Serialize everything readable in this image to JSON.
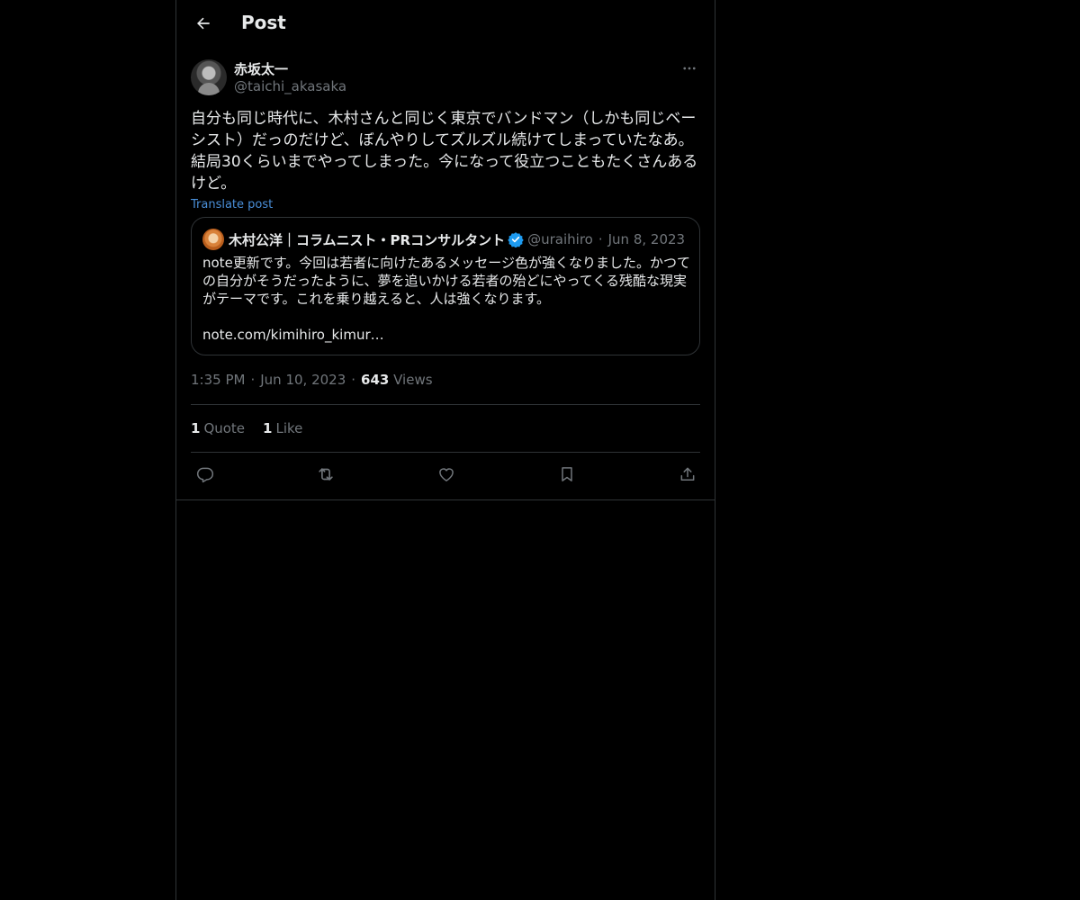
{
  "header": {
    "title": "Post"
  },
  "post": {
    "author_name": "赤坂太一",
    "author_handle": "@taichi_akasaka",
    "text": "自分も同じ時代に、木村さんと同じく東京でバンドマン（しかも同じベー\nシスト）だっのだけど、ぼんやりしてズルズル続けてしまっていたなあ。\n結局30くらいまでやってしまった。今になって役立つこともたくさんある\nけど。",
    "translate_label": "Translate post",
    "time": "1:35 PM",
    "date": "Jun 10, 2023",
    "views_count": "643",
    "views_label": "Views",
    "quotes_count": "1",
    "quotes_label": "Quote",
    "likes_count": "1",
    "likes_label": "Like"
  },
  "quote": {
    "author_name": "木村公洋｜コラムニスト・PRコンサルタント",
    "verified": true,
    "author_handle": "@uraihiro",
    "date": "Jun 8, 2023",
    "text": "note更新です。今回は若者に向けたあるメッセージ色が強くなりました。かつて\nの自分がそうだったように、夢を追いかける若者の殆どにやってくる残酷な現実\nがテーマです。これを乗り越えると、人は強くなります。\n\nnote.com/kimihiro_kimur…"
  },
  "actions": [
    "reply-icon",
    "repost-icon",
    "like-icon",
    "bookmark-icon",
    "share-icon"
  ],
  "colors": {
    "background": "#000000",
    "text": "#e7e9ea",
    "muted": "#71767b",
    "border": "#2f3336",
    "link": "#4a8fd9",
    "verified": "#1d9bf0"
  }
}
